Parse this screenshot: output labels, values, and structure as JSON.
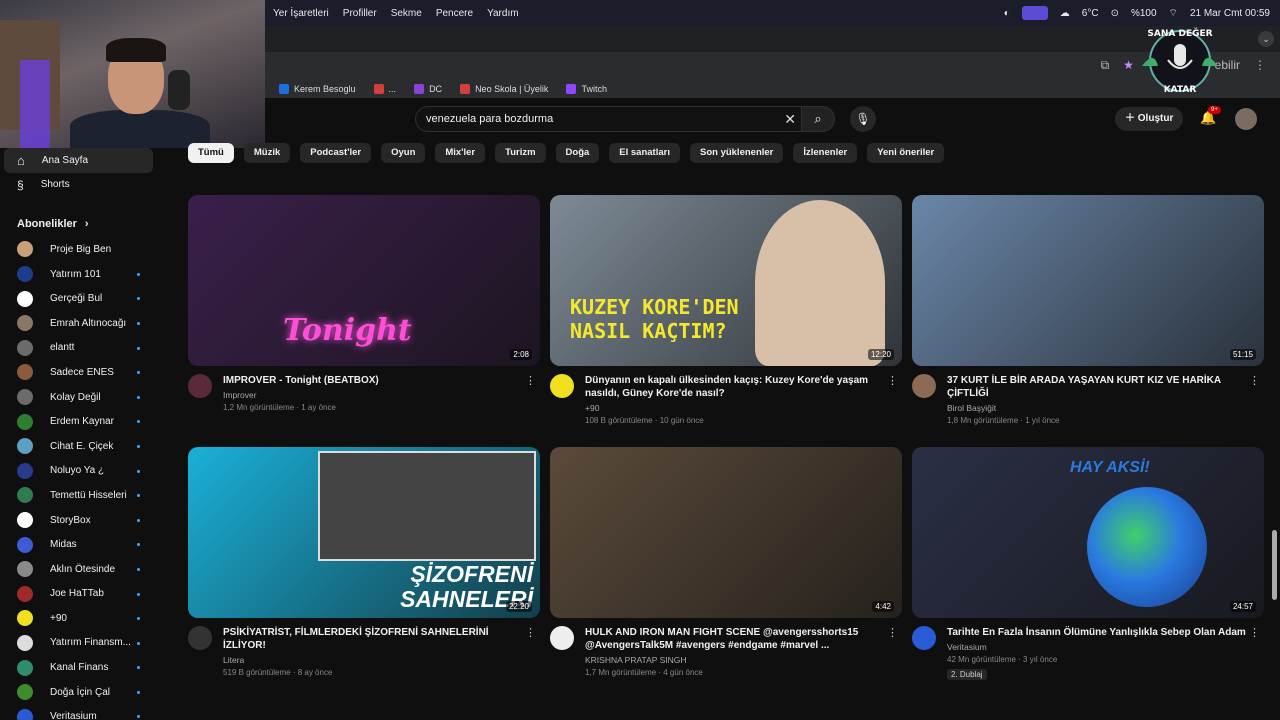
{
  "macbar": {
    "menu": [
      "Yer İşaretleri",
      "Profiller",
      "Sekme",
      "Pencere",
      "Yardım"
    ],
    "temp": "6°C",
    "battery": "%100",
    "datetime": "21 Mar Cmt  00:59"
  },
  "bookmarks": [
    {
      "label": "Kerem Besoglu",
      "color": "#1d6fe0"
    },
    {
      "label": "...",
      "color": "#d23f3f"
    },
    {
      "label": "DC",
      "color": "#8a44d6"
    },
    {
      "label": "Neo Skola | Üyelik",
      "color": "#d23f3f"
    },
    {
      "label": "Twitch",
      "color": "#9146ff"
    }
  ],
  "addr_fragment": "ebilir",
  "logo": {
    "line1": "SANA DEĞER",
    "line2": "KATAR"
  },
  "search": {
    "query": "venezuela para bozdurma"
  },
  "header": {
    "create": "Oluştur",
    "notif_count": "9+"
  },
  "sidebar": {
    "home": "Ana Sayfa",
    "shorts": "Shorts",
    "subs_heading": "Abonelikler",
    "subs": [
      {
        "name": "Proje Big Ben",
        "color": "#c9a07a",
        "dot": false
      },
      {
        "name": "Yatırım 101",
        "color": "#1c3d8c",
        "dot": true
      },
      {
        "name": "Gerçeği Bul",
        "color": "#ffffff",
        "dot": true
      },
      {
        "name": "Emrah Altınocağı",
        "color": "#8b7765",
        "dot": true
      },
      {
        "name": "elantt",
        "color": "#6b6b6b",
        "dot": true
      },
      {
        "name": "Sadece ENES",
        "color": "#8c5a3c",
        "dot": true
      },
      {
        "name": "Kolay Değil",
        "color": "#6b6b6b",
        "dot": true
      },
      {
        "name": "Erdem Kaynar",
        "color": "#2f7d2f",
        "dot": true
      },
      {
        "name": "Cihat E. Çiçek",
        "color": "#5ca0c4",
        "dot": true
      },
      {
        "name": "Noluyo Ya ¿",
        "color": "#2a3a8c",
        "dot": true
      },
      {
        "name": "Temettü Hisseleri",
        "color": "#2f7d4f",
        "dot": true
      },
      {
        "name": "StoryBox",
        "color": "#ffffff",
        "dot": true
      },
      {
        "name": "Midas",
        "color": "#3d5bd6",
        "dot": true
      },
      {
        "name": "Aklın Ötesinde",
        "color": "#8a8a8a",
        "dot": true
      },
      {
        "name": "Joe HaTTab",
        "color": "#a02a2a",
        "dot": true
      },
      {
        "name": "+90",
        "color": "#f0e020",
        "dot": true
      },
      {
        "name": "Yatırım Finansm...",
        "color": "#dddddd",
        "dot": true
      },
      {
        "name": "Kanal Finans",
        "color": "#2f8d6f",
        "dot": true
      },
      {
        "name": "Doğa İçin Çal",
        "color": "#3c8c2c",
        "dot": true
      },
      {
        "name": "Veritasium",
        "color": "#2a5bd6",
        "dot": true
      }
    ]
  },
  "chips": [
    "Tümü",
    "Müzik",
    "Podcast'ler",
    "Oyun",
    "Mix'ler",
    "Turizm",
    "Doğa",
    "El sanatları",
    "Son yüklenenler",
    "İzlenenler",
    "Yeni öneriler"
  ],
  "videos": [
    {
      "title": "IMPROVER - Tonight (BEATBOX)",
      "channel": "Improver",
      "stats": "1,2 Mn görüntüleme · 1 ay önce",
      "duration": "2:08",
      "overlay": "Tonight",
      "bg": "#3a1f4a",
      "accent": "#ff4fd8",
      "avatar": "#5a2a3a"
    },
    {
      "title": "Dünyanın en kapalı ülkesinden kaçış: Kuzey Kore'de yaşam nasıldı, Güney Kore'de nasıl?",
      "channel": "+90",
      "stats": "108 B görüntüleme · 10 gün önce",
      "duration": "12:20",
      "overlay": "KUZEY KORE'DEN NASIL KAÇTIM?",
      "bg": "#7d8a96",
      "accent": "#f5e82a",
      "avatar": "#f0e020"
    },
    {
      "title": "37 KURT İLE BİR ARADA YAŞAYAN KURT KIZ VE HARİKA ÇİFTLİĞİ",
      "channel": "Birol Başyiğit",
      "stats": "1,8 Mn görüntüleme · 1 yıl önce",
      "duration": "51:15",
      "overlay": "",
      "bg": "#6a86a8",
      "accent": "#ffffff",
      "avatar": "#8c6a55"
    },
    {
      "title": "PSİKİYATRİST, FİLMLERDEKİ ŞİZOFRENİ SAHNELERİNİ İZLİYOR!",
      "channel": "Litera",
      "stats": "519 B görüntüleme · 8 ay önce",
      "duration": "22:20",
      "overlay": "ŞİZOFRENİ SAHNELERİ",
      "bg": "#1ab0d8",
      "accent": "#ffffff",
      "avatar": "#333333"
    },
    {
      "title": "HULK AND IRON MAN FIGHT SCENE  @avengersshorts15 @AvengersTalk5M #avengers #endgame #marvel ...",
      "channel": "KRISHNA PRATAP SINGH",
      "stats": "1,7 Mn görüntüleme · 4 gün önce",
      "duration": "4:42",
      "overlay": "",
      "bg": "#5a4a3a",
      "accent": "#b5412a",
      "avatar": "#eeeeee"
    },
    {
      "title": "Tarihte En Fazla İnsanın Ölümüne Yanlışlıkla Sebep Olan Adam",
      "channel": "Veritasium",
      "stats": "42 Mn görüntüleme · 3 yıl önce",
      "duration": "24:57",
      "overlay": "HAY AKSİ!",
      "bg": "#2a2f45",
      "accent": "#2a7ae0",
      "avatar": "#2a5bd6",
      "badge": "2. Dublaj"
    }
  ]
}
